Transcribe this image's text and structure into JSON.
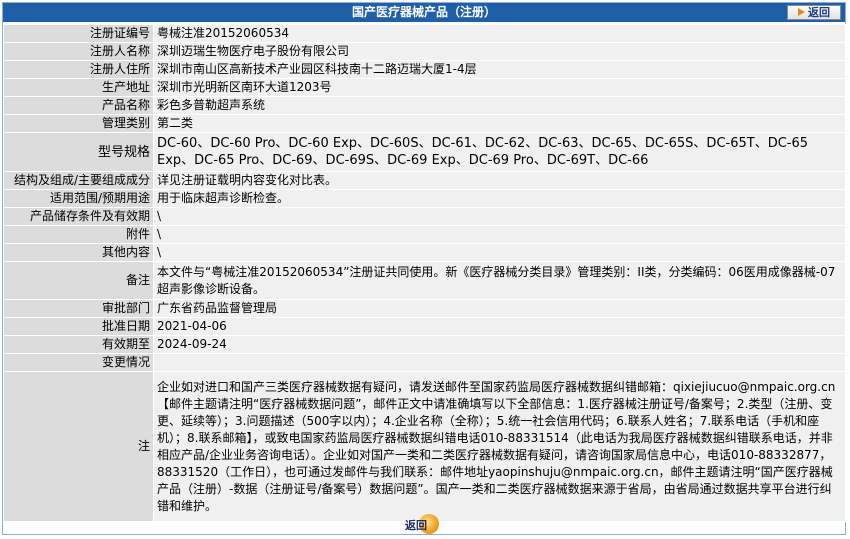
{
  "header": {
    "title": "国产医疗器械产品（注册）",
    "back_label": "返回"
  },
  "fields": {
    "reg_no": {
      "label": "注册证编号",
      "value": "粤械注准20152060534"
    },
    "registrant": {
      "label": "注册人名称",
      "value": "深圳迈瑞生物医疗电子股份有限公司"
    },
    "reg_address": {
      "label": "注册人住所",
      "value": "深圳市南山区高新技术产业园区科技南十二路迈瑞大厦1-4层"
    },
    "prod_address": {
      "label": "生产地址",
      "value": "深圳市光明新区南环大道1203号"
    },
    "product_name": {
      "label": "产品名称",
      "value": "彩色多普勒超声系统"
    },
    "mgmt_class": {
      "label": "管理类别",
      "value": "第二类"
    },
    "model_spec": {
      "label": "型号规格",
      "value": "DC-60、DC-60 Pro、DC-60 Exp、DC-60S、DC-61、DC-62、DC-63、DC-65、DC-65S、DC-65T、DC-65 Exp、DC-65 Pro、DC-69、DC-69S、DC-69 Exp、DC-69 Pro、DC-69T、DC-66"
    },
    "structure": {
      "label": "结构及组成/主要组成成分",
      "value": "详见注册证载明内容变化对比表。"
    },
    "scope": {
      "label": "适用范围/预期用途",
      "value": "用于临床超声诊断检查。"
    },
    "storage": {
      "label": "产品储存条件及有效期",
      "value": "\\"
    },
    "attachment": {
      "label": "附件",
      "value": "\\"
    },
    "other": {
      "label": "其他内容",
      "value": "\\"
    },
    "remarks": {
      "label": "备注",
      "value": "本文件与“粤械注准20152060534”注册证共同使用。新《医疗器械分类目录》管理类别：II类，分类编码：06医用成像器械-07超声影像诊断设备。"
    },
    "approval_dept": {
      "label": "审批部门",
      "value": "广东省药品监督管理局"
    },
    "approval_date": {
      "label": "批准日期",
      "value": "2021-04-06"
    },
    "valid_until": {
      "label": "有效期至",
      "value": "2024-09-24"
    },
    "changes": {
      "label": "变更情况",
      "value": ""
    },
    "note": {
      "label": "注",
      "value": "企业如对进口和国产三类医疗器械数据有疑问，请发送邮件至国家药监局医疗器械数据纠错邮箱：qixiejiucuo@nmpaic.org.cn【邮件主题请注明“医疗器械数据问题”，邮件正文中请准确填写以下全部信息：1.医疗器械注册证号/备案号；2.类型（注册、变更、延续等）；3.问题描述（500字以内）；4.企业名称（全称）；5.统一社会信用代码；6.联系人姓名；7.联系电话（手机和座机）；8.联系邮箱】，或致电国家药监局医疗器械数据纠错电话010-88331514（此电话为我局医疗器械数据纠错联系电话，并非相应产品/企业业务咨询电话）。企业如对国产一类和二类医疗器械数据有疑问，请咨询国家局信息中心，电话010-88332877，88331520（工作日），也可通过发邮件与我们联系：邮件地址yaopinshuju@nmpaic.org.cn，邮件主题请注明“国产医疗器械产品（注册）-数据（注册证号/备案号）数据问题”。国产一类和二类医疗器械数据来源于省局，由省局通过数据共享平台进行纠错和维护。"
    }
  },
  "footer": {
    "back_label": "返回"
  }
}
